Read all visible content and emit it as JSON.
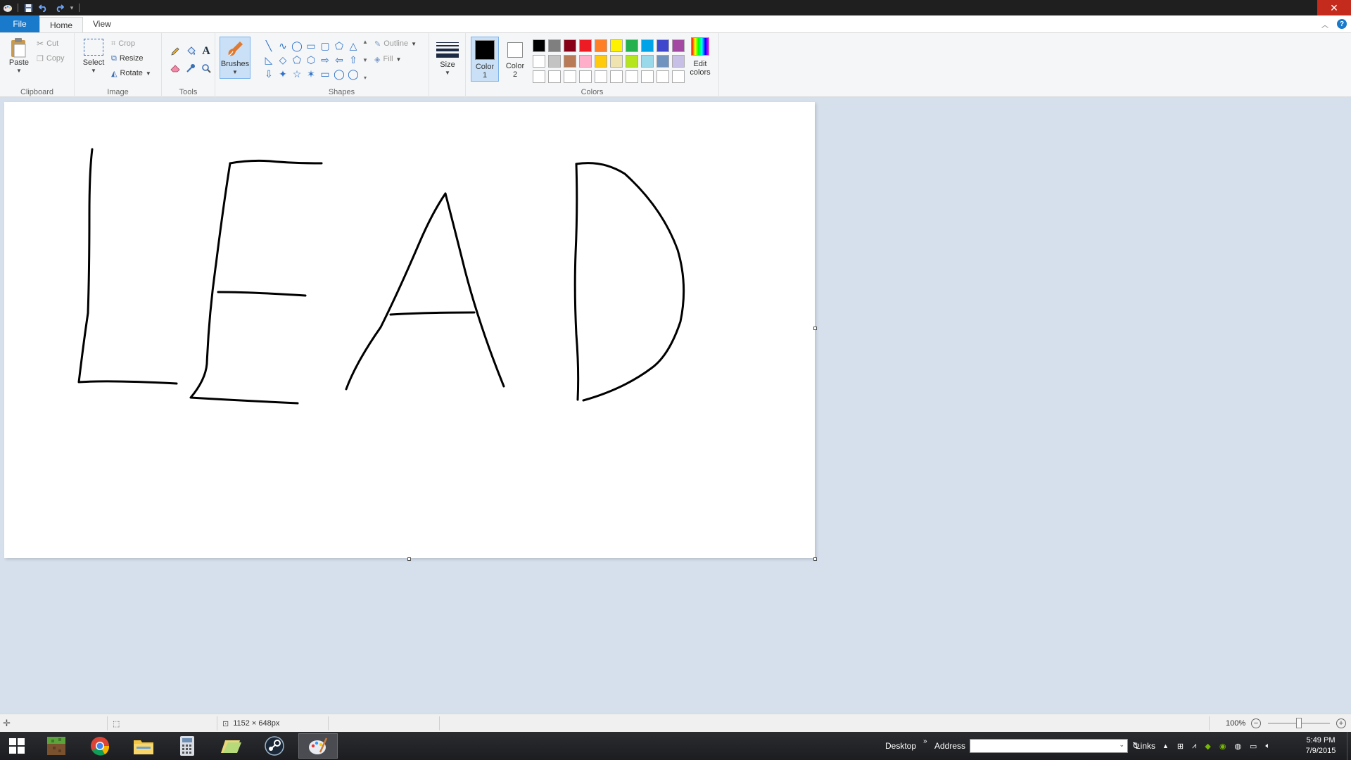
{
  "quick_access": {
    "save_icon": "save-icon",
    "undo_icon": "undo-icon",
    "redo_icon": "redo-icon"
  },
  "window": {
    "close": "✕"
  },
  "tabs": {
    "file": "File",
    "home": "Home",
    "view": "View"
  },
  "clipboard": {
    "paste": "Paste",
    "cut": "Cut",
    "copy": "Copy",
    "label": "Clipboard"
  },
  "image": {
    "select": "Select",
    "crop": "Crop",
    "resize": "Resize",
    "rotate": "Rotate",
    "label": "Image"
  },
  "tools": {
    "label": "Tools"
  },
  "brushes": {
    "label": "Brushes"
  },
  "shapes": {
    "label": "Shapes",
    "outline": "Outline",
    "fill": "Fill",
    "glyphs": [
      "╲",
      "∿",
      "◯",
      "▭",
      "▢",
      "⬠",
      "△",
      "◺",
      "◇",
      "⬠",
      "⬡",
      "⇨",
      "⇦",
      "⇧",
      "⇩",
      "✦",
      "☆",
      "✶",
      "▭",
      "◯",
      "◯"
    ]
  },
  "size": {
    "label": "Size"
  },
  "colors": {
    "color1": "Color 1",
    "color2": "Color 2",
    "edit": "Edit colors",
    "label": "Colors",
    "color1_value": "#000000",
    "color2_value": "#ffffff",
    "palette": [
      "#000000",
      "#7f7f7f",
      "#880015",
      "#ed1c24",
      "#ff7f27",
      "#fff200",
      "#22b14c",
      "#00a2e8",
      "#3f48cc",
      "#a349a4",
      "#ffffff",
      "#c3c3c3",
      "#b97a57",
      "#ffaec9",
      "#ffc90e",
      "#efe4b0",
      "#b5e61d",
      "#99d9ea",
      "#7092be",
      "#c8bfe7",
      "#ffffff",
      "#ffffff",
      "#ffffff",
      "#ffffff",
      "#ffffff",
      "#ffffff",
      "#ffffff",
      "#ffffff",
      "#ffffff",
      "#ffffff"
    ]
  },
  "statusbar": {
    "dimensions": "1152 × 648px",
    "zoom": "100%"
  },
  "taskbar": {
    "desktop": "Desktop",
    "address": "Address",
    "address_value": "",
    "links": "Links",
    "time": "5:49 PM",
    "date": "7/9/2015",
    "apps": [
      "minecraft-icon",
      "chrome-icon",
      "file-explorer-icon",
      "calculator-icon",
      "folder-icon",
      "steam-icon",
      "paint-icon"
    ]
  }
}
